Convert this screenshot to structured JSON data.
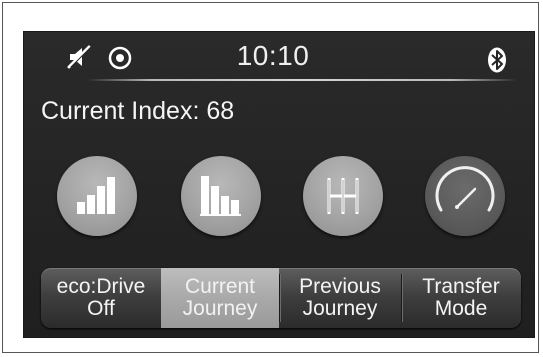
{
  "status_bar": {
    "time": "10:10",
    "icons": [
      "mute-icon",
      "target-icon",
      "bluetooth-icon"
    ]
  },
  "index": {
    "label": "Current Index: 68"
  },
  "round_buttons": [
    {
      "icon": "signal-bars-icon"
    },
    {
      "icon": "bar-chart-icon"
    },
    {
      "icon": "gear-shift-icon"
    },
    {
      "icon": "gauge-icon"
    }
  ],
  "tabs": [
    {
      "line1": "eco:Drive",
      "line2": "Off",
      "selected": false
    },
    {
      "line1": "Current",
      "line2": "Journey",
      "selected": true
    },
    {
      "line1": "Previous",
      "line2": "Journey",
      "selected": false
    },
    {
      "line1": "Transfer",
      "line2": "Mode",
      "selected": false
    }
  ],
  "colors": {
    "screen_bg": "#262626",
    "text": "#f0f0f0",
    "button_gray": "#a6a6a6",
    "button_dark": "#5a5a5a",
    "tab_selected": "#a9a9a9"
  }
}
